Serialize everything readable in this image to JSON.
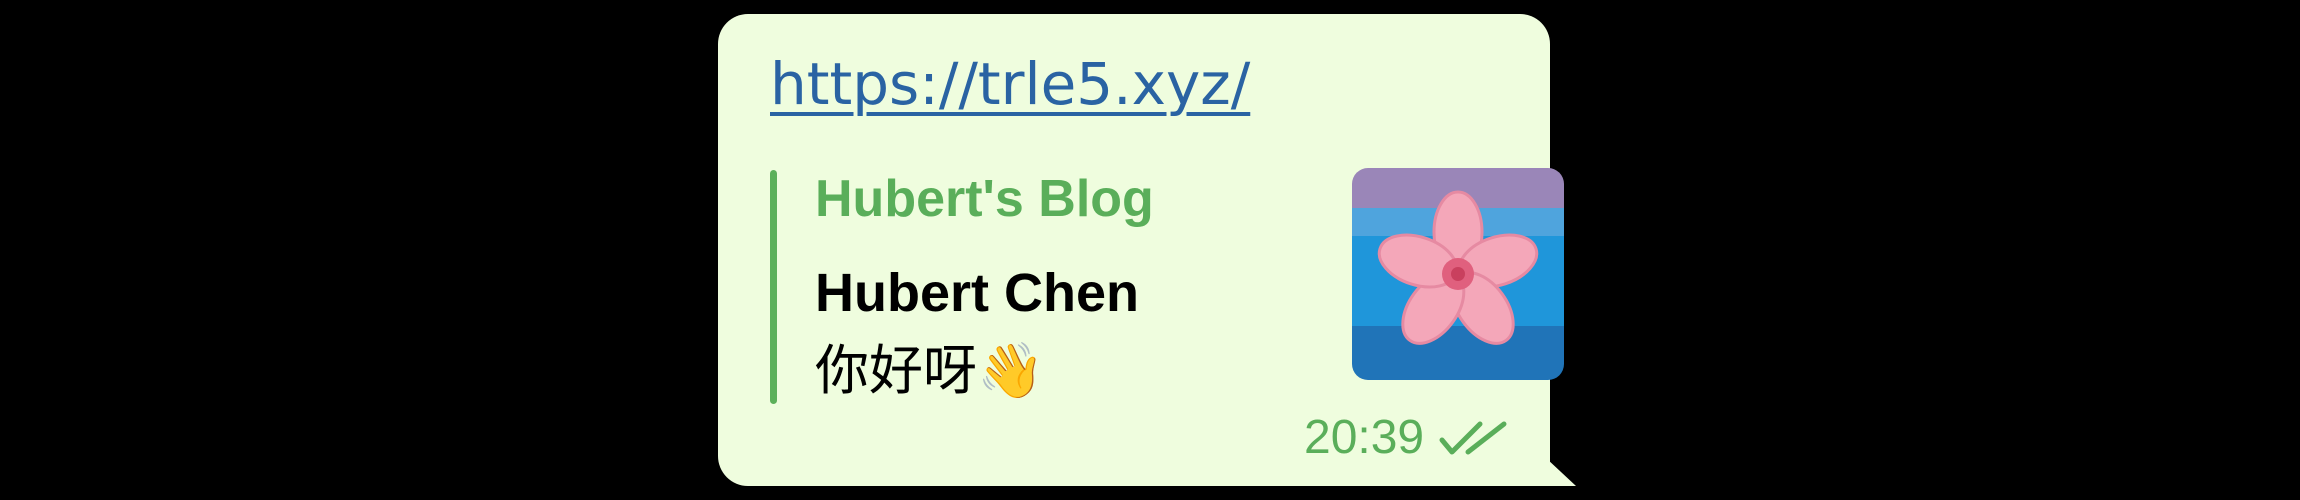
{
  "message": {
    "link_text": "https://trle5.xyz/",
    "preview": {
      "site_name": "Hubert's Blog",
      "title": "Hubert Chen",
      "description": "你好呀👋",
      "thumbnail_icon": "cherry-blossom-icon"
    },
    "time": "20:39",
    "status_icon": "double-check-icon"
  },
  "colors": {
    "bubble_bg": "#effdde",
    "link": "#2a63a3",
    "accent_green": "#5aae5a",
    "page_bg": "#000000"
  }
}
